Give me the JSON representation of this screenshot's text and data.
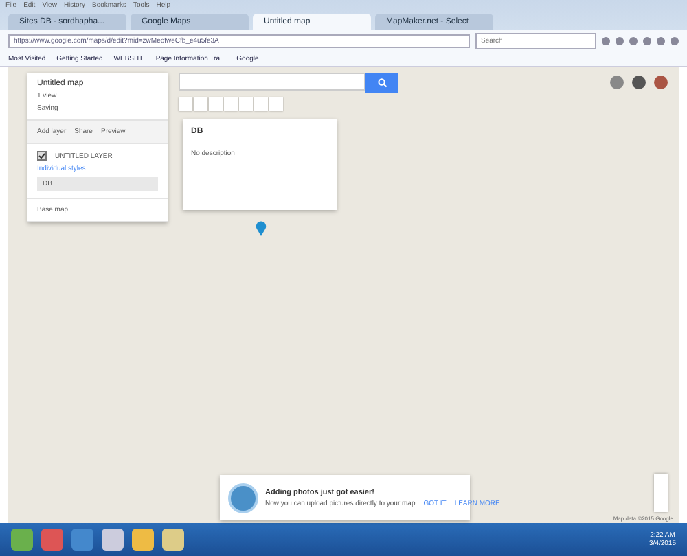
{
  "browser": {
    "menu": [
      "File",
      "Edit",
      "View",
      "History",
      "Bookmarks",
      "Tools",
      "Help"
    ],
    "tabs": [
      {
        "label": "Sites DB - sordhapha...",
        "selected": false
      },
      {
        "label": "Google Maps",
        "selected": false
      },
      {
        "label": "Untitled map",
        "selected": true
      },
      {
        "label": "MapMaker.net - Select",
        "selected": false
      }
    ],
    "address": "https://www.google.com/maps/d/edit?mid=zwMeofweCfb_e4u5fe3A",
    "search_placeholder": "Search",
    "bookmarks": [
      "Most Visited",
      "Getting Started",
      "WEBSITE",
      "Page Information Tra...",
      "Google"
    ]
  },
  "map_panel": {
    "title": "Untitled map",
    "views": "1 view",
    "status": "Saving",
    "actions": [
      "Add layer",
      "Share",
      "Preview"
    ],
    "layer": {
      "name": "UNTITLED LAYER",
      "checked": true,
      "style": "Individual styles",
      "items": [
        {
          "label": "DB",
          "selected": true
        }
      ]
    },
    "base_map": "Base map"
  },
  "popup": {
    "title": "DB",
    "description": "No description"
  },
  "notice": {
    "title": "Adding photos just got easier!",
    "body": "Now you can upload pictures directly to your map",
    "buttons": [
      "GOT IT",
      "LEARN MORE"
    ]
  },
  "map_footer": "Map data ©2015 Google",
  "taskbar": {
    "time": "2:22 AM",
    "date": "3/4/2015"
  }
}
